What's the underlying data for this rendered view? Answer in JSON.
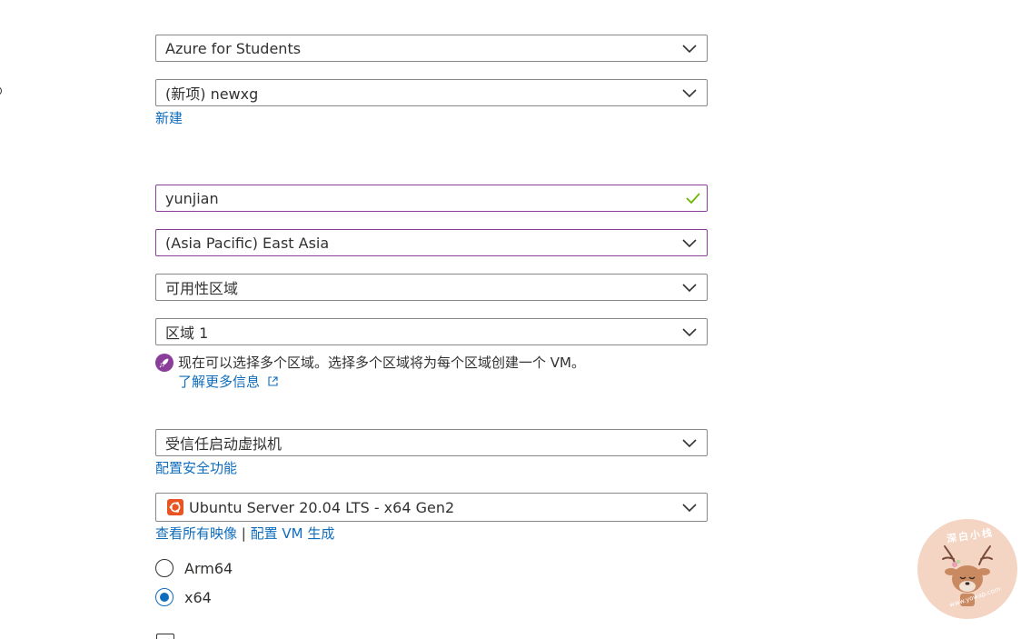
{
  "form": {
    "subscription": {
      "value": "Azure for Students"
    },
    "resource_group": {
      "value": "(新项) newxg",
      "create_link": "新建"
    },
    "vm_name": {
      "value": "yunjian"
    },
    "region": {
      "value": "(Asia Pacific) East Asia"
    },
    "availability_options": {
      "value": "可用性区域"
    },
    "availability_zone": {
      "value": "区域 1",
      "info_text": "现在可以选择多个区域。选择多个区域将为每个区域创建一个 VM。",
      "learn_more_link": "了解更多信息"
    },
    "security_type": {
      "value": "受信任启动虚拟机",
      "config_link": "配置安全功能"
    },
    "image": {
      "value": "Ubuntu Server 20.04 LTS - x64 Gen2",
      "see_all_link": "查看所有映像",
      "separator": "|",
      "config_link": "配置 VM 生成"
    },
    "architecture": {
      "options": [
        {
          "label": "Arm64",
          "selected": false
        },
        {
          "label": "x64",
          "selected": true
        }
      ]
    }
  },
  "watermark": {
    "text": "深白小栈",
    "url": "www.yowap.com"
  },
  "colors": {
    "accent": "#0f6cbd",
    "focus_border": "#8a3e9a",
    "success_check": "#6bb700",
    "ubuntu_orange": "#e95420"
  }
}
